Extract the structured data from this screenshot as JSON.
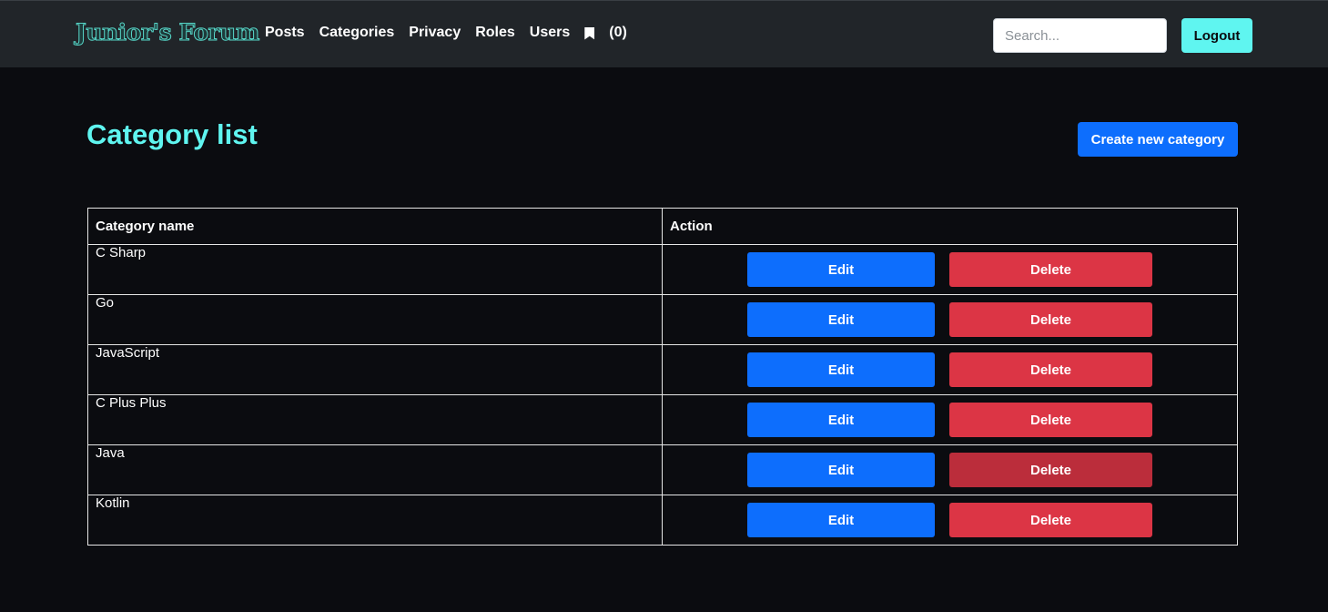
{
  "navbar": {
    "brand": "Junior's Forum",
    "links": [
      "Posts",
      "Categories",
      "Privacy",
      "Roles",
      "Users"
    ],
    "bookmark_count": "(0)",
    "search_placeholder": "Search...",
    "logout_label": "Logout"
  },
  "page": {
    "title": "Category list",
    "create_label": "Create new category"
  },
  "table": {
    "headers": [
      "Category name",
      "Action"
    ],
    "rows": [
      {
        "name": "C Sharp",
        "edit": "Edit",
        "delete": "Delete"
      },
      {
        "name": "Go",
        "edit": "Edit",
        "delete": "Delete"
      },
      {
        "name": "JavaScript",
        "edit": "Edit",
        "delete": "Delete"
      },
      {
        "name": "C Plus Plus",
        "edit": "Edit",
        "delete": "Delete"
      },
      {
        "name": "Java",
        "edit": "Edit",
        "delete": "Delete"
      },
      {
        "name": "Kotlin",
        "edit": "Edit",
        "delete": "Delete"
      }
    ]
  },
  "colors": {
    "accent": "#5ff5f0",
    "primary": "#0d6efd",
    "danger": "#dc3545",
    "danger_hover": "#bb2d3b",
    "background": "#0b0c10",
    "navbar": "#212529"
  },
  "icons": {
    "bookmark": "bookmark-icon"
  }
}
